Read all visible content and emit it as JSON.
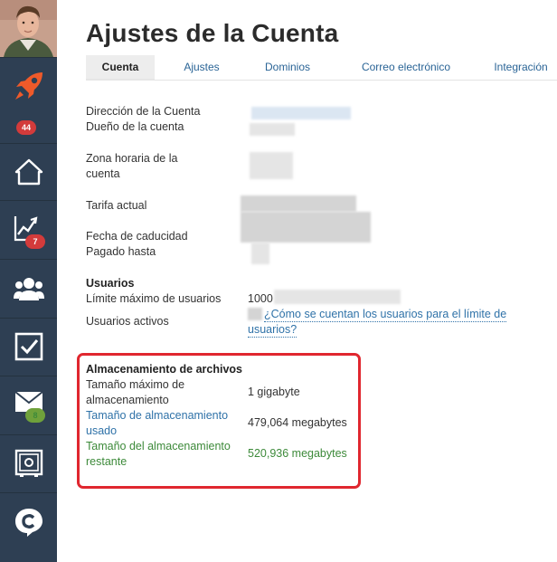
{
  "page": {
    "title": "Ajustes de la Cuenta"
  },
  "tabs": [
    {
      "label": "Cuenta",
      "active": true
    },
    {
      "label": "Ajustes",
      "active": false
    },
    {
      "label": "Dominios",
      "active": false
    },
    {
      "label": "Correo electrónico",
      "active": false
    },
    {
      "label": "Integración",
      "active": false
    }
  ],
  "sidebar": {
    "items": [
      {
        "icon": "rocket-icon",
        "badge": null
      },
      {
        "icon": "home-icon",
        "badge": "44",
        "badge_color": "#d33b3b"
      },
      {
        "icon": "chart-icon",
        "badge": "7",
        "badge_color": "#d33b3b"
      },
      {
        "icon": "users-icon",
        "badge": null
      },
      {
        "icon": "checkbox-icon",
        "badge": null
      },
      {
        "icon": "mail-icon",
        "badge": "8",
        "badge_color": "#6fa13b"
      },
      {
        "icon": "safe-icon",
        "badge": null
      },
      {
        "icon": "chat-icon",
        "badge": null
      }
    ]
  },
  "account": {
    "address_label": "Dirección de la Cuenta",
    "owner_label": "Dueño de la cuenta",
    "timezone_label_line1": "Zona horaria de la",
    "timezone_label_line2": "cuenta",
    "plan_label": "Tarifa actual",
    "expiry_label": "Fecha de caducidad",
    "paid_until_label": "Pagado hasta"
  },
  "users": {
    "title": "Usuarios",
    "max_label": "Límite máximo de usuarios",
    "max_value": "1000",
    "active_label": "Usuarios activos",
    "help_link_line1": "¿Cómo se cuentan los usuarios para el límite de",
    "help_link_line2": "usuarios?"
  },
  "storage": {
    "title": "Almacenamiento de archivos",
    "max_label_line1": "Tamaño máximo de",
    "max_label_line2": "almacenamiento",
    "max_value": "1 gigabyte",
    "used_label_line1": "Tamaño de almacenamiento",
    "used_label_line2": "usado",
    "used_value": "479,064 megabytes",
    "remaining_label_line1": "Tamaño del almacenamiento",
    "remaining_label_line2": "restante",
    "remaining_value": "520,936 megabytes"
  },
  "colors": {
    "sidebar_bg": "#2e3f53",
    "accent_orange": "#ef5a2a",
    "link_blue": "#2f72a8",
    "remaining_green": "#3d8a3a",
    "highlight_red": "#e0272f"
  }
}
